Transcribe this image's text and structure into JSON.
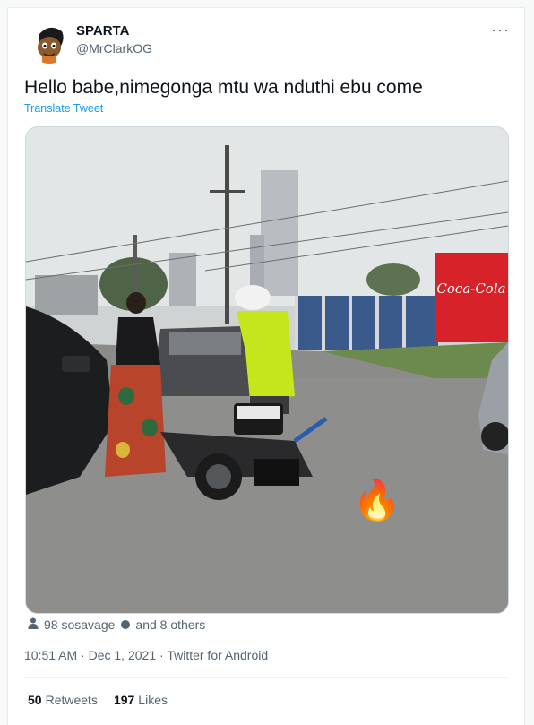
{
  "user": {
    "name": "SPARTA",
    "handle": "@MrClarkOG"
  },
  "menu": {
    "more_label": "···"
  },
  "tweet": {
    "text": "Hello babe,nimegonga mtu wa nduthi ebu come",
    "translate_label": "Translate Tweet",
    "emoji": "🔥"
  },
  "tagged": {
    "first": "98 sosavage",
    "others": "and 8 others"
  },
  "meta": {
    "time": "10:51 AM",
    "date": "Dec 1, 2021",
    "source": "Twitter for Android"
  },
  "stats": {
    "retweets_count": "50",
    "retweets_label": "Retweets",
    "likes_count": "197",
    "likes_label": "Likes"
  },
  "photo": {
    "billboard_text": "Coca-Cola"
  },
  "colors": {
    "accent": "#1d9bf0",
    "muted": "#536471",
    "text": "#0f1419",
    "billboard": "#d7222a"
  }
}
